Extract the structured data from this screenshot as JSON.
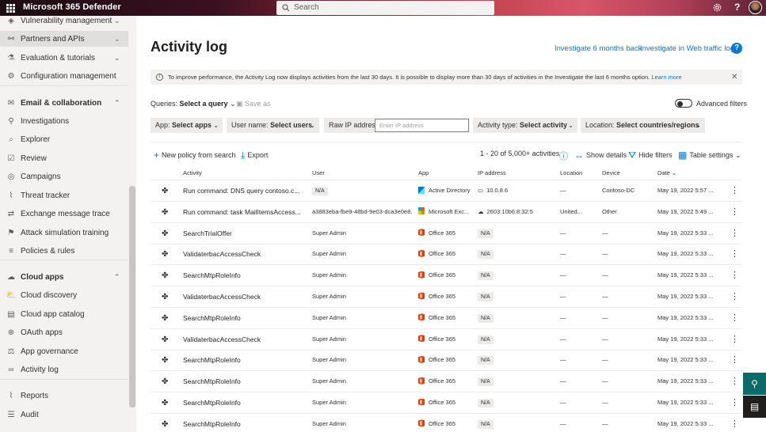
{
  "topbar": {
    "brand": "Microsoft 365 Defender",
    "search_placeholder": "Search",
    "help": "?"
  },
  "sidebar": {
    "items": [
      {
        "label": "Vulnerability management",
        "icon": "shield-icon",
        "chev": "⌄",
        "head": false
      },
      {
        "label": "Partners and APIs",
        "icon": "link-icon",
        "chev": "⌄",
        "head": false,
        "sel": true
      },
      {
        "label": "Evaluation & tutorials",
        "icon": "beaker-icon",
        "chev": "⌄",
        "head": false
      },
      {
        "label": "Configuration management",
        "icon": "config-icon",
        "chev": "",
        "head": false
      },
      {
        "label": "Email & collaboration",
        "icon": "mail-icon",
        "chev": "⌃",
        "head": true
      },
      {
        "label": "Investigations",
        "icon": "investigate-icon",
        "chev": "",
        "head": false
      },
      {
        "label": "Explorer",
        "icon": "explorer-icon",
        "chev": "",
        "head": false
      },
      {
        "label": "Review",
        "icon": "review-icon",
        "chev": "",
        "head": false
      },
      {
        "label": "Campaigns",
        "icon": "target-icon",
        "chev": "",
        "head": false
      },
      {
        "label": "Threat tracker",
        "icon": "chart-icon",
        "chev": "",
        "head": false
      },
      {
        "label": "Exchange message trace",
        "icon": "exchange-icon",
        "chev": "",
        "head": false
      },
      {
        "label": "Attack simulation training",
        "icon": "hook-icon",
        "chev": "",
        "head": false
      },
      {
        "label": "Policies & rules",
        "icon": "policy-icon",
        "chev": "",
        "head": false
      },
      {
        "label": "Cloud apps",
        "icon": "cloud-icon",
        "chev": "⌃",
        "head": true
      },
      {
        "label": "Cloud discovery",
        "icon": "cloud-discovery-icon",
        "chev": "",
        "head": false
      },
      {
        "label": "Cloud app catalog",
        "icon": "catalog-icon",
        "chev": "",
        "head": false
      },
      {
        "label": "OAuth apps",
        "icon": "oauth-icon",
        "chev": "",
        "head": false
      },
      {
        "label": "App governance",
        "icon": "governance-icon",
        "chev": "",
        "head": false
      },
      {
        "label": "Activity log",
        "icon": "glasses-icon",
        "chev": "",
        "head": false,
        "active": true
      },
      {
        "label": "Reports",
        "icon": "reports-icon",
        "chev": "",
        "head": false
      },
      {
        "label": "Audit",
        "icon": "audit-icon",
        "chev": "",
        "head": false
      }
    ]
  },
  "page": {
    "title": "Activity log",
    "link_6months": "Investigate 6 months back",
    "link_web": "Investigate in Web traffic log",
    "notice_text": "To improve performance, the Activity Log now displays activities from the last 30 days. It is possible to display more than 30 days of activities in the Investigate the last 6 months option.",
    "notice_link": "Learn more",
    "queries_label": "Queries:",
    "queries_value": "Select a query",
    "save_as": "Save as",
    "advanced_filters": "Advanced filters",
    "filters": {
      "app_label": "App:",
      "app_value": "Select apps",
      "user_label": "User name:",
      "user_value": "Select users",
      "ip_label": "Raw IP address:",
      "ip_placeholder": "Enter IP address",
      "type_label": "Activity type:",
      "type_value": "Select activity",
      "loc_label": "Location:",
      "loc_value": "Select countries/regions"
    },
    "new_policy": "New policy from search",
    "export": "Export",
    "count": "1 - 20 of 5,000+ activities",
    "show_details": "Show details",
    "hide_filters": "Hide filters",
    "table_settings": "Table settings"
  },
  "table": {
    "headers": {
      "activity": "Activity",
      "user": "User",
      "app": "App",
      "ip": "IP address",
      "location": "Location",
      "device": "Device",
      "date": "Date"
    },
    "rows": [
      {
        "activity": "Run command: DNS query contoso.c...",
        "user": "N/A",
        "user_pill": true,
        "app": "Active Directory",
        "app_icon": "ad",
        "ip": "10.0.8.6",
        "ip_icon": "▭",
        "location": "—",
        "device": "Contoso-DC",
        "date": "May 19, 2022 5:57 ..."
      },
      {
        "activity": "Run command: task MailItemsAccess...",
        "user": "a3883eba-fbe9-48bd-9e03-dca3e0e8...",
        "user_pill": false,
        "app": "Microsoft Exc...",
        "app_icon": "ms",
        "ip": "2603:10b6:8:32:5",
        "ip_icon": "☁",
        "location": "United...",
        "device": "Other",
        "date": "May 19, 2022 5:49 ..."
      },
      {
        "activity": "SearchTrialOffer",
        "user": "Super Admin",
        "user_pill": false,
        "app": "Office 365",
        "app_icon": "o365",
        "ip": "N/A",
        "ip_icon": "",
        "location": "—",
        "device": "—",
        "date": "May 19, 2022 5:33 ..."
      },
      {
        "activity": "ValidaterbacAccessCheck",
        "user": "Super Admin",
        "user_pill": false,
        "app": "Office 365",
        "app_icon": "o365",
        "ip": "N/A",
        "ip_icon": "",
        "location": "—",
        "device": "—",
        "date": "May 19, 2022 5:33 ..."
      },
      {
        "activity": "SearchMtpRoleInfo",
        "user": "Super Admin",
        "user_pill": false,
        "app": "Office 365",
        "app_icon": "o365",
        "ip": "N/A",
        "ip_icon": "",
        "location": "—",
        "device": "—",
        "date": "May 19, 2022 5:33 ..."
      },
      {
        "activity": "ValidaterbacAccessCheck",
        "user": "Super Admin",
        "user_pill": false,
        "app": "Office 365",
        "app_icon": "o365",
        "ip": "N/A",
        "ip_icon": "",
        "location": "—",
        "device": "—",
        "date": "May 19, 2022 5:33 ..."
      },
      {
        "activity": "SearchMtpRoleInfo",
        "user": "Super Admin",
        "user_pill": false,
        "app": "Office 365",
        "app_icon": "o365",
        "ip": "N/A",
        "ip_icon": "",
        "location": "—",
        "device": "—",
        "date": "May 19, 2022 5:33 ..."
      },
      {
        "activity": "ValidaterbacAccessCheck",
        "user": "Super Admin",
        "user_pill": false,
        "app": "Office 365",
        "app_icon": "o365",
        "ip": "N/A",
        "ip_icon": "",
        "location": "—",
        "device": "—",
        "date": "May 19, 2022 5:33 ..."
      },
      {
        "activity": "SearchMtpRoleInfo",
        "user": "Super Admin",
        "user_pill": false,
        "app": "Office 365",
        "app_icon": "o365",
        "ip": "N/A",
        "ip_icon": "",
        "location": "—",
        "device": "—",
        "date": "May 19, 2022 5:33 ..."
      },
      {
        "activity": "SearchMtpRoleInfo",
        "user": "Super Admin",
        "user_pill": false,
        "app": "Office 365",
        "app_icon": "o365",
        "ip": "N/A",
        "ip_icon": "",
        "location": "—",
        "device": "—",
        "date": "May 19, 2022 5:33 ..."
      },
      {
        "activity": "SearchMtpRoleInfo",
        "user": "Super Admin",
        "user_pill": false,
        "app": "Office 365",
        "app_icon": "o365",
        "ip": "N/A",
        "ip_icon": "",
        "location": "—",
        "device": "—",
        "date": "May 19, 2022 5:33 ..."
      },
      {
        "activity": "SearchMtpRoleInfo",
        "user": "Super Admin",
        "user_pill": false,
        "app": "Office 365",
        "app_icon": "o365",
        "ip": "N/A",
        "ip_icon": "",
        "location": "—",
        "device": "—",
        "date": "May 19, 2022 5:33 ..."
      }
    ]
  },
  "colors": {
    "accent": "#0078d4",
    "fab": "#0b6a6a"
  }
}
